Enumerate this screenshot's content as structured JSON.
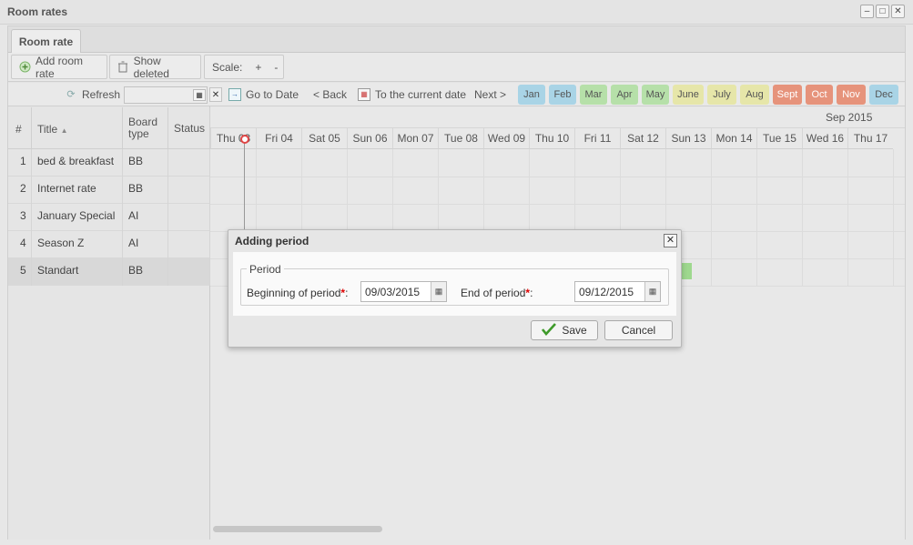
{
  "window": {
    "title": "Room rates"
  },
  "tab": {
    "label": "Room rate"
  },
  "toolbar": {
    "add_label": "Add room rate",
    "deleted_label": "Show deleted",
    "scale_label": "Scale:",
    "scale_plus": "+",
    "scale_minus": "-"
  },
  "nav": {
    "refresh_label": "Refresh",
    "search_value": "",
    "goto_label": "Go to Date",
    "back_label": "< Back",
    "current_label": "To the current date",
    "next_label": "Next >"
  },
  "months": [
    {
      "label": "Jan",
      "color": "#a9d4e6"
    },
    {
      "label": "Feb",
      "color": "#a9d4e6"
    },
    {
      "label": "Mar",
      "color": "#b6e0a9"
    },
    {
      "label": "Apr",
      "color": "#b6e0a9"
    },
    {
      "label": "May",
      "color": "#b6e0a9"
    },
    {
      "label": "June",
      "color": "#e6e6a9"
    },
    {
      "label": "July",
      "color": "#e6e6a9"
    },
    {
      "label": "Aug",
      "color": "#e6e6a9"
    },
    {
      "label": "Sept",
      "color": "#e6937b"
    },
    {
      "label": "Oct",
      "color": "#e6937b"
    },
    {
      "label": "Nov",
      "color": "#e6937b"
    },
    {
      "label": "Dec",
      "color": "#a9d4e6"
    }
  ],
  "table": {
    "headers": {
      "num": "#",
      "title": "Title",
      "board": "Board type",
      "status": "Status"
    },
    "rows": [
      {
        "num": "1",
        "title": "bed & breakfast",
        "board": "BB"
      },
      {
        "num": "2",
        "title": "Internet rate",
        "board": "BB"
      },
      {
        "num": "3",
        "title": "January Special",
        "board": "AI"
      },
      {
        "num": "4",
        "title": "Season Z",
        "board": "AI"
      },
      {
        "num": "5",
        "title": "Standart",
        "board": "BB"
      }
    ]
  },
  "timeline": {
    "month_label": "Sep 2015",
    "days": [
      "Thu 03",
      "Fri 04",
      "Sat 05",
      "Sun 06",
      "Mon 07",
      "Tue 08",
      "Wed 09",
      "Thu 10",
      "Fri 11",
      "Sat 12",
      "Sun 13",
      "Mon 14",
      "Tue 15",
      "Wed 16",
      "Thu 17"
    ]
  },
  "dialog": {
    "title": "Adding period",
    "legend": "Period",
    "begin_label": "Beginning of period",
    "begin_value": "09/03/2015",
    "end_label": "End of period",
    "end_value": "09/12/2015",
    "required_mark": "*",
    "colon": ":",
    "save_label": "Save",
    "cancel_label": "Cancel"
  },
  "colors": {
    "accent_green": "#9ed88e",
    "marker_red": "#e04545"
  }
}
